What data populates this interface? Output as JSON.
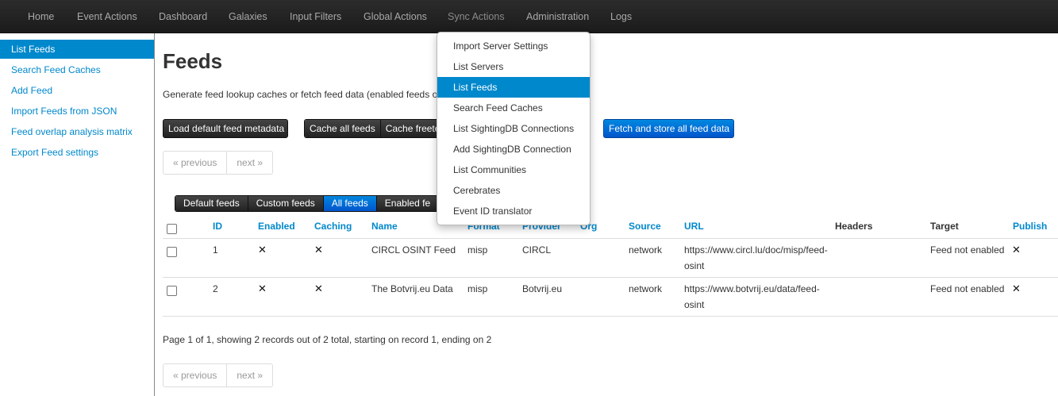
{
  "nav": {
    "items": [
      "Home",
      "Event Actions",
      "Dashboard",
      "Galaxies",
      "Input Filters",
      "Global Actions",
      "Sync Actions",
      "Administration",
      "Logs"
    ]
  },
  "sidebar": {
    "items": [
      "List Feeds",
      "Search Feed Caches",
      "Add Feed",
      "Import Feeds from JSON",
      "Feed overlap analysis matrix",
      "Export Feed settings"
    ]
  },
  "main": {
    "title": "Feeds",
    "description": "Generate feed lookup caches or fetch feed data (enabled feeds o",
    "buttons": {
      "load_default": "Load default feed metadata",
      "cache_all": "Cache all feeds",
      "cache_freetext": "Cache freete",
      "fetch_store": "Fetch and store all feed data"
    },
    "pager": {
      "previous": "« previous",
      "next": "next »"
    },
    "filters": [
      "Default feeds",
      "Custom feeds",
      "All feeds",
      "Enabled fe"
    ],
    "table": {
      "headers": {
        "id": "ID",
        "enabled": "Enabled",
        "caching": "Caching",
        "name": "Name",
        "format": "Format",
        "provider": "Provider",
        "org": "Org",
        "source": "Source",
        "url": "URL",
        "headers": "Headers",
        "target": "Target",
        "publish": "Publish"
      },
      "rows": [
        {
          "id": "1",
          "name": "CIRCL OSINT Feed",
          "format": "misp",
          "provider": "CIRCL",
          "source": "network",
          "url": "https://www.circl.lu/doc/misp/feed-osint",
          "target": "Feed not enabled"
        },
        {
          "id": "2",
          "name": "The Botvrij.eu Data",
          "format": "misp",
          "provider": "Botvrij.eu",
          "source": "network",
          "url": "https://www.botvrij.eu/data/feed-osint",
          "target": "Feed not enabled"
        }
      ]
    },
    "footer": "Page 1 of 1, showing 2 records out of 2 total, starting on record 1, ending on 2"
  },
  "dropdown": {
    "items": [
      "Import Server Settings",
      "List Servers",
      "List Feeds",
      "Search Feed Caches",
      "List SightingDB Connections",
      "Add SightingDB Connection",
      "List Communities",
      "Cerebrates",
      "Event ID translator"
    ]
  },
  "icons": {
    "cross": "✕"
  },
  "colors": {
    "link": "#0088cc",
    "primary": "#0066cc",
    "navbar": "#222222"
  }
}
